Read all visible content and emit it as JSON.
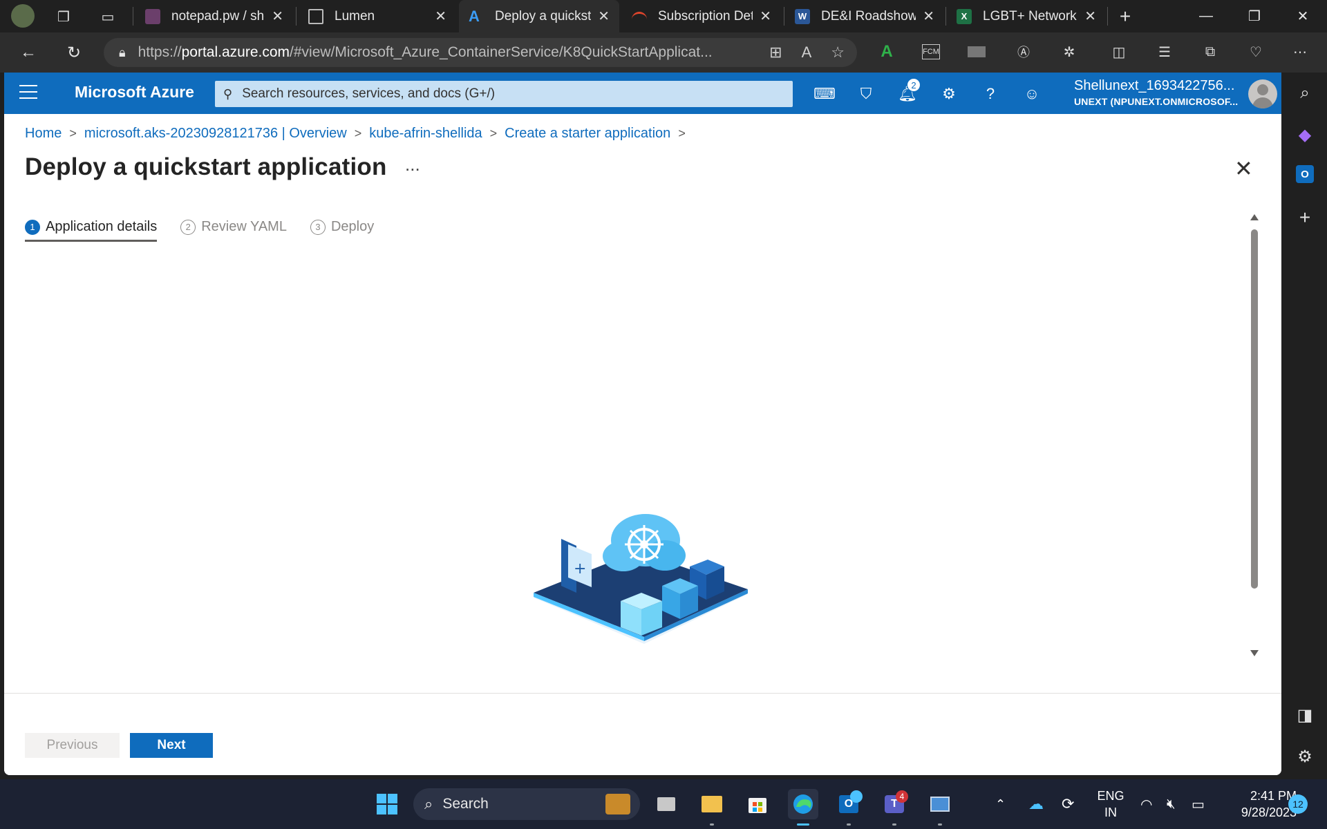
{
  "browser": {
    "tabs": [
      {
        "title": "notepad.pw / she",
        "active": false
      },
      {
        "title": "Lumen",
        "active": false
      },
      {
        "title": "Deploy a quickst",
        "active": true
      },
      {
        "title": "Subscription Deta",
        "active": false
      },
      {
        "title": "DE&I Roadshows",
        "active": false
      },
      {
        "title": "LGBT+ Network",
        "active": false
      }
    ],
    "url_prefix": "https://",
    "url_host": "portal.azure.com",
    "url_rest": "/#view/Microsoft_Azure_ContainerService/K8QuickStartApplicat..."
  },
  "azure": {
    "brand": "Microsoft Azure",
    "search_placeholder": "Search resources, services, and docs (G+/)",
    "notification_count": "2",
    "account_name": "Shellunext_1693422756...",
    "account_tenant": "UNEXT (NPUNEXT.ONMICROSOF..."
  },
  "breadcrumb": [
    "Home",
    "microsoft.aks-20230928121736 | Overview",
    "kube-afrin-shellida",
    "Create a starter application"
  ],
  "page": {
    "title": "Deploy a quickstart application",
    "more": "..."
  },
  "steps": [
    {
      "num": "1",
      "label": "Application details",
      "active": true
    },
    {
      "num": "2",
      "label": "Review YAML",
      "active": false
    },
    {
      "num": "3",
      "label": "Deploy",
      "active": false
    }
  ],
  "footer": {
    "previous_label": "Previous",
    "next_label": "Next"
  },
  "taskbar": {
    "search_label": "Search",
    "lang_line1": "ENG",
    "lang_line2": "IN",
    "time": "2:41 PM",
    "date": "9/28/2023",
    "notifications": "12",
    "outlook_badge": "",
    "teams_badge": "4"
  },
  "colors": {
    "azure_blue": "#0f6cbd",
    "taskbar": "#1c2233",
    "chrome_dark": "#202020"
  }
}
